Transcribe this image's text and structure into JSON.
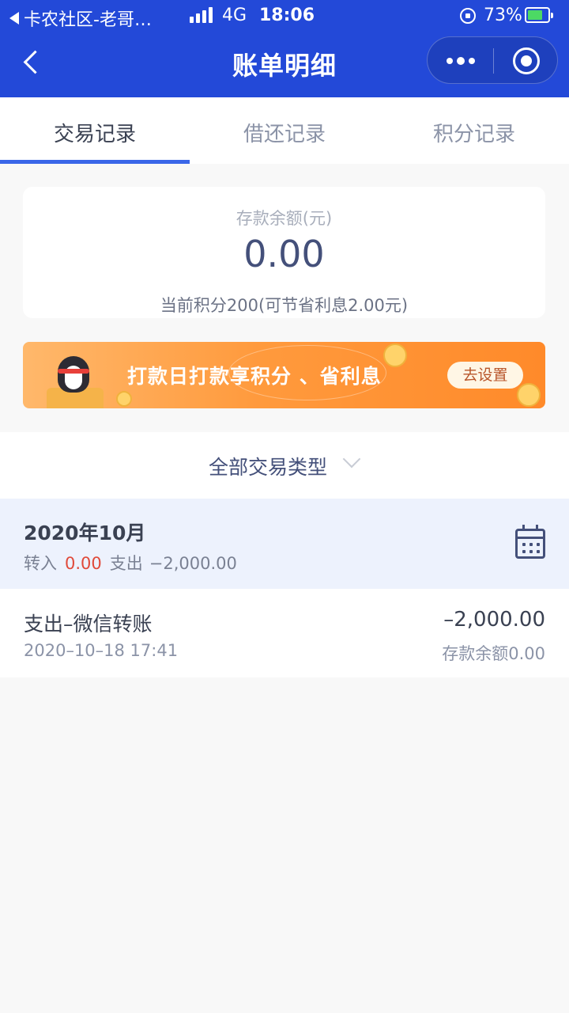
{
  "status_bar": {
    "back_app": "卡农社区-老哥…",
    "network": "4G",
    "time": "18:06",
    "battery_percent": "73%",
    "battery_level": 0.73
  },
  "navbar": {
    "title": "账单明细",
    "accent_color": "#2349d8"
  },
  "tabs": [
    {
      "label": "交易记录",
      "active": true
    },
    {
      "label": "借还记录",
      "active": false
    },
    {
      "label": "积分记录",
      "active": false
    }
  ],
  "balance": {
    "label": "存款余额(元)",
    "amount": "0.00",
    "points_note": "当前积分200(可节省利息2.00元)"
  },
  "banner": {
    "text": "打款日打款享积分 、省利息",
    "cta": "去设置"
  },
  "filter": {
    "label": "全部交易类型"
  },
  "month": {
    "title": "2020年10月",
    "in_label": "转入",
    "in_value": "0.00",
    "out_label": "支出",
    "out_value": "−2,000.00"
  },
  "transactions": [
    {
      "name": "支出–微信转账",
      "date": "2020–10–18 17:41",
      "amount": "–2,000.00",
      "balance_after": "存款余额0.00"
    }
  ]
}
